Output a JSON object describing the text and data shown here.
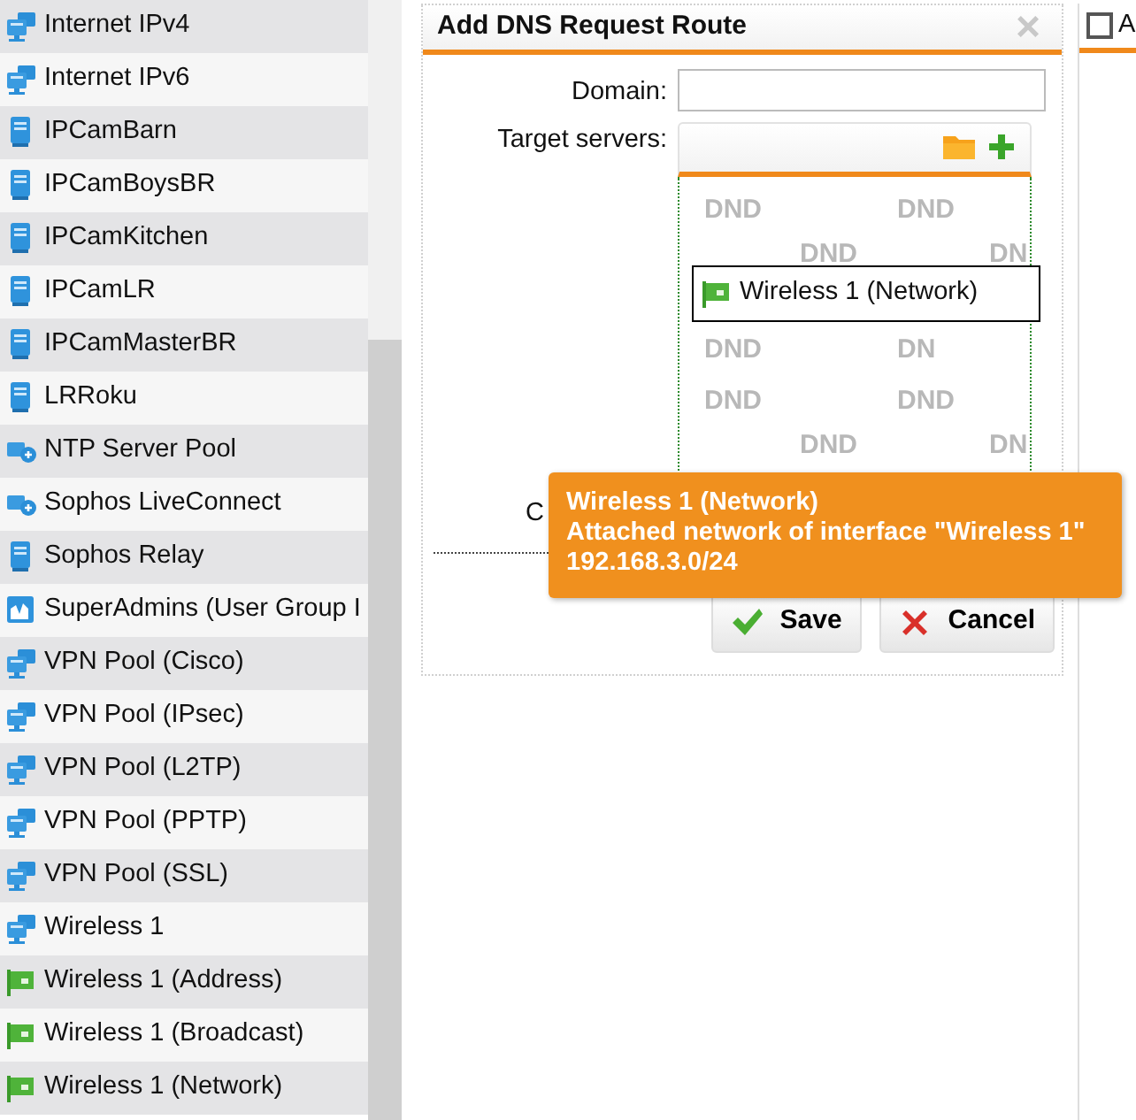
{
  "definitions": [
    {
      "label": "Internet IPv4",
      "kind": "network"
    },
    {
      "label": "Internet IPv6",
      "kind": "network"
    },
    {
      "label": "IPCamBarn",
      "kind": "host"
    },
    {
      "label": "IPCamBoysBR",
      "kind": "host"
    },
    {
      "label": "IPCamKitchen",
      "kind": "host"
    },
    {
      "label": "IPCamLR",
      "kind": "host"
    },
    {
      "label": "IPCamMasterBR",
      "kind": "host"
    },
    {
      "label": "LRRoku",
      "kind": "host"
    },
    {
      "label": "NTP Server Pool",
      "kind": "service"
    },
    {
      "label": "Sophos LiveConnect",
      "kind": "service"
    },
    {
      "label": "Sophos Relay",
      "kind": "host"
    },
    {
      "label": "SuperAdmins (User Group I",
      "kind": "group"
    },
    {
      "label": "VPN Pool (Cisco)",
      "kind": "network"
    },
    {
      "label": "VPN Pool (IPsec)",
      "kind": "network"
    },
    {
      "label": "VPN Pool (L2TP)",
      "kind": "network"
    },
    {
      "label": "VPN Pool (PPTP)",
      "kind": "network"
    },
    {
      "label": "VPN Pool (SSL)",
      "kind": "network"
    },
    {
      "label": "Wireless 1",
      "kind": "network"
    },
    {
      "label": "Wireless 1 (Address)",
      "kind": "interface"
    },
    {
      "label": "Wireless 1 (Broadcast)",
      "kind": "interface"
    },
    {
      "label": "Wireless 1 (Network)",
      "kind": "interface"
    }
  ],
  "dialog": {
    "title": "Add DNS Request Route",
    "close": "×",
    "domain_label": "Domain:",
    "target_label": "Target servers:",
    "drop_marks": [
      [
        "DND",
        "DND"
      ],
      [
        "DND",
        "DN"
      ],
      [
        "DND",
        "DN"
      ],
      [
        "DND",
        "DND"
      ],
      [
        "DND",
        "DN"
      ]
    ],
    "targets": [
      {
        "label": "Wireless 1 (Network)",
        "kind": "interface"
      }
    ],
    "comment_label": "C",
    "buttons": [
      {
        "label": "Save",
        "kind": "save"
      },
      {
        "label": "Cancel",
        "kind": "cancel"
      }
    ]
  },
  "tooltip": {
    "title": "Wireless 1 (Network)",
    "description": "Attached network of interface \"Wireless 1\"",
    "address": "192.168.3.0/24"
  },
  "side_panel": {
    "checked": false,
    "heading": "A"
  }
}
